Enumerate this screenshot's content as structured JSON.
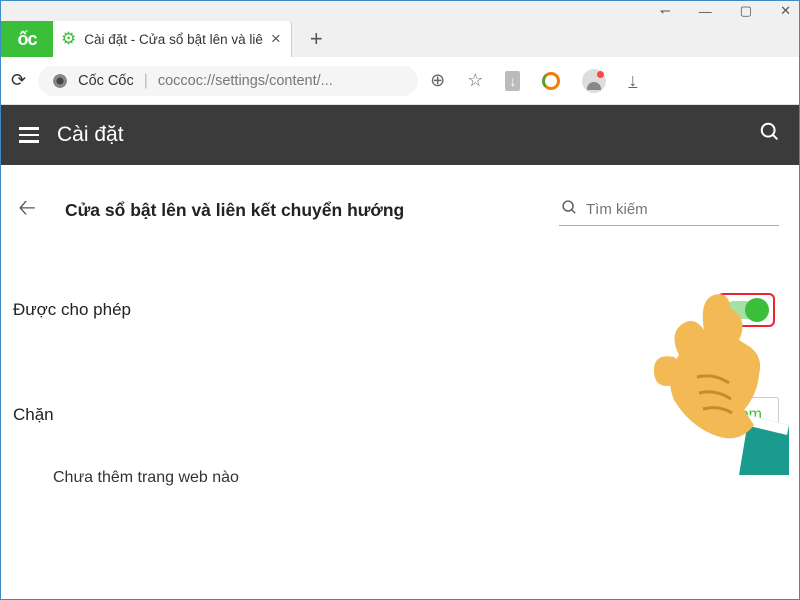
{
  "window": {
    "logo": "ốc"
  },
  "tab": {
    "title": "Cài đặt - Cửa sổ bật lên và liê"
  },
  "addressbar": {
    "site_name": "Cốc Cốc",
    "url_display": "coccoc://settings/content/..."
  },
  "settings_header": {
    "title": "Cài đặt"
  },
  "page": {
    "section_title": "Cửa sổ bật lên và liên kết chuyển hướng",
    "search_placeholder": "Tìm kiếm",
    "allowed_label": "Được cho phép",
    "block_label": "Chặn",
    "add_button": "em",
    "empty_text": "Chưa thêm trang web nào"
  }
}
